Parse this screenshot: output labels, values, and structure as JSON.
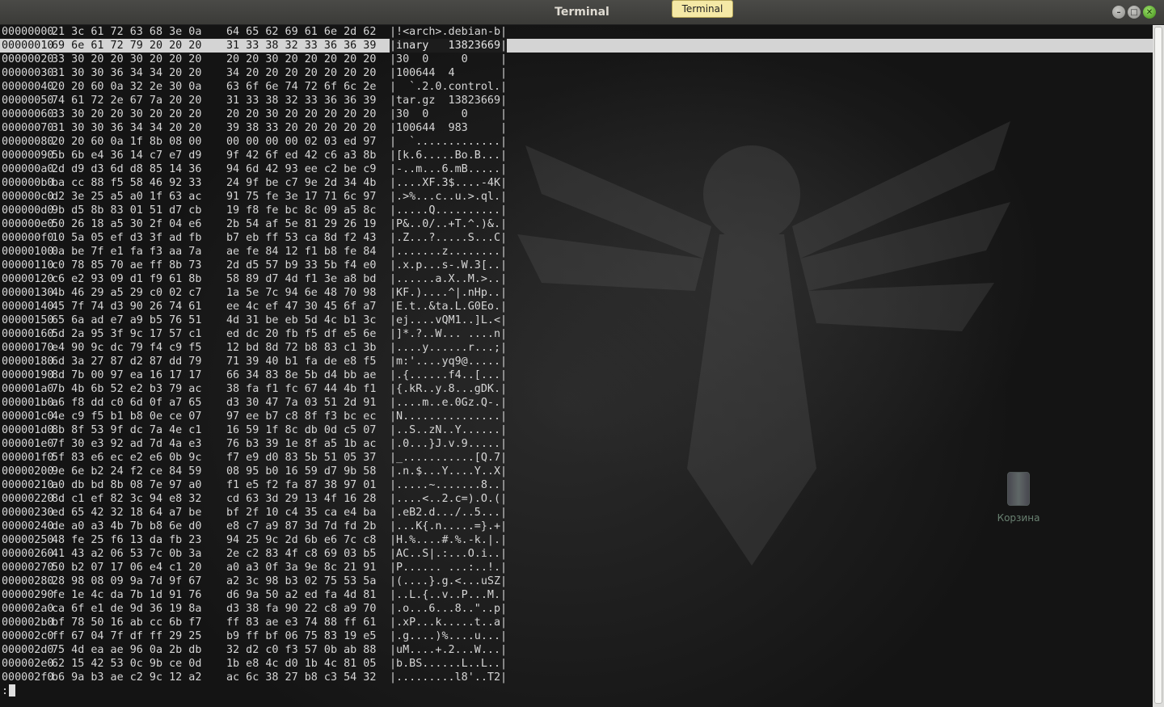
{
  "window": {
    "title": "Terminal",
    "tooltip": "Terminal",
    "buttons": {
      "minimize": "–",
      "maximize": "□",
      "close": "✕"
    }
  },
  "desktop": {
    "trash_label": "Корзина"
  },
  "colors": {
    "selection": "#d4d4d4",
    "text": "#d6d6d6",
    "close_button": "#4caf1e"
  },
  "terminal": {
    "selected_row": 1,
    "prompt": ":",
    "rows": [
      {
        "offset": "00000000",
        "hex1": "21 3c 61 72 63 68 3e 0a",
        "hex2": "64 65 62 69 61 6e 2d 62",
        "ascii": "|!<arch>.debian-b|"
      },
      {
        "offset": "00000010",
        "hex1": "69 6e 61 72 79 20 20 20",
        "hex2": "31 33 38 32 33 36 36 39",
        "ascii": "|inary   13823669|"
      },
      {
        "offset": "00000020",
        "hex1": "33 30 20 20 30 20 20 20",
        "hex2": "20 20 30 20 20 20 20 20",
        "ascii": "|30  0     0     |"
      },
      {
        "offset": "00000030",
        "hex1": "31 30 30 36 34 34 20 20",
        "hex2": "34 20 20 20 20 20 20 20",
        "ascii": "|100644  4       |"
      },
      {
        "offset": "00000040",
        "hex1": "20 20 60 0a 32 2e 30 0a",
        "hex2": "63 6f 6e 74 72 6f 6c 2e",
        "ascii": "|  `.2.0.control.|"
      },
      {
        "offset": "00000050",
        "hex1": "74 61 72 2e 67 7a 20 20",
        "hex2": "31 33 38 32 33 36 36 39",
        "ascii": "|tar.gz  13823669|"
      },
      {
        "offset": "00000060",
        "hex1": "33 30 20 20 30 20 20 20",
        "hex2": "20 20 30 20 20 20 20 20",
        "ascii": "|30  0     0     |"
      },
      {
        "offset": "00000070",
        "hex1": "31 30 30 36 34 34 20 20",
        "hex2": "39 38 33 20 20 20 20 20",
        "ascii": "|100644  983     |"
      },
      {
        "offset": "00000080",
        "hex1": "20 20 60 0a 1f 8b 08 00",
        "hex2": "00 00 00 00 02 03 ed 97",
        "ascii": "|  `.............|"
      },
      {
        "offset": "00000090",
        "hex1": "5b 6b e4 36 14 c7 e7 d9",
        "hex2": "9f 42 6f ed 42 c6 a3 8b",
        "ascii": "|[k.6.....Bo.B...|"
      },
      {
        "offset": "000000a0",
        "hex1": "2d d9 d3 6d d8 85 14 36",
        "hex2": "94 6d 42 93 ee c2 be c9",
        "ascii": "|-..m...6.mB.....|"
      },
      {
        "offset": "000000b0",
        "hex1": "ba cc 88 f5 58 46 92 33",
        "hex2": "24 9f be c7 9e 2d 34 4b",
        "ascii": "|....XF.3$....-4K|"
      },
      {
        "offset": "000000c0",
        "hex1": "d2 3e 25 a5 a0 1f 63 ac",
        "hex2": "91 75 fe 3e 17 71 6c 97",
        "ascii": "|.>%...c..u.>.ql.|"
      },
      {
        "offset": "000000d0",
        "hex1": "9b d5 8b 83 01 51 d7 cb",
        "hex2": "19 f8 fe bc 8c 09 a5 8c",
        "ascii": "|.....Q..........|"
      },
      {
        "offset": "000000e0",
        "hex1": "50 26 18 a5 30 2f 04 e6",
        "hex2": "2b 54 af 5e 81 29 26 19",
        "ascii": "|P&..0/..+T.^.)&.|"
      },
      {
        "offset": "000000f0",
        "hex1": "10 5a 05 ef d3 3f ad fb",
        "hex2": "b7 eb ff 53 ca 8d f2 43",
        "ascii": "|.Z...?.....S...C|"
      },
      {
        "offset": "00000100",
        "hex1": "0a be 7f e1 fa f3 aa 7a",
        "hex2": "ae fe 84 12 f1 b8 fe 84",
        "ascii": "|.......z........|"
      },
      {
        "offset": "00000110",
        "hex1": "c0 78 85 70 ae ff 8b 73",
        "hex2": "2d d5 57 b9 33 5b f4 e0",
        "ascii": "|.x.p...s-.W.3[..|"
      },
      {
        "offset": "00000120",
        "hex1": "c6 e2 93 09 d1 f9 61 8b",
        "hex2": "58 89 d7 4d f1 3e a8 bd",
        "ascii": "|......a.X..M.>..|"
      },
      {
        "offset": "00000130",
        "hex1": "4b 46 29 a5 29 c0 02 c7",
        "hex2": "1a 5e 7c 94 6e 48 70 98",
        "ascii": "|KF.)....^|.nHp..|"
      },
      {
        "offset": "00000140",
        "hex1": "45 7f 74 d3 90 26 74 61",
        "hex2": "ee 4c ef 47 30 45 6f a7",
        "ascii": "|E.t..&ta.L.G0Eo.|"
      },
      {
        "offset": "00000150",
        "hex1": "65 6a ad e7 a9 b5 76 51",
        "hex2": "4d 31 be eb 5d 4c b1 3c",
        "ascii": "|ej....vQM1..]L.<|"
      },
      {
        "offset": "00000160",
        "hex1": "5d 2a 95 3f 9c 17 57 c1",
        "hex2": "ed dc 20 fb f5 df e5 6e",
        "ascii": "|]*.?..W... ....n|"
      },
      {
        "offset": "00000170",
        "hex1": "e4 90 9c dc 79 f4 c9 f5",
        "hex2": "12 bd 8d 72 b8 83 c1 3b",
        "ascii": "|....y......r...;|"
      },
      {
        "offset": "00000180",
        "hex1": "6d 3a 27 87 d2 87 dd 79",
        "hex2": "71 39 40 b1 fa de e8 f5",
        "ascii": "|m:'....yq9@.....|"
      },
      {
        "offset": "00000190",
        "hex1": "8d 7b 00 97 ea 16 17 17",
        "hex2": "66 34 83 8e 5b d4 bb ae",
        "ascii": "|.{......f4..[...|"
      },
      {
        "offset": "000001a0",
        "hex1": "7b 4b 6b 52 e2 b3 79 ac",
        "hex2": "38 fa f1 fc 67 44 4b f1",
        "ascii": "|{.kR..y.8...gDK.|"
      },
      {
        "offset": "000001b0",
        "hex1": "a6 f8 dd c0 6d 0f a7 65",
        "hex2": "d3 30 47 7a 03 51 2d 91",
        "ascii": "|....m..e.0Gz.Q-.|"
      },
      {
        "offset": "000001c0",
        "hex1": "4e c9 f5 b1 b8 0e ce 07",
        "hex2": "97 ee b7 c8 8f f3 bc ec",
        "ascii": "|N...............|"
      },
      {
        "offset": "000001d0",
        "hex1": "8b 8f 53 9f dc 7a 4e c1",
        "hex2": "16 59 1f 8c db 0d c5 07",
        "ascii": "|..S..zN..Y......|"
      },
      {
        "offset": "000001e0",
        "hex1": "7f 30 e3 92 ad 7d 4a e3",
        "hex2": "76 b3 39 1e 8f a5 1b ac",
        "ascii": "|.0...}J.v.9.....|"
      },
      {
        "offset": "000001f0",
        "hex1": "5f 83 e6 ec e2 e6 0b 9c",
        "hex2": "f7 e9 d0 83 5b 51 05 37",
        "ascii": "|_...........[Q.7|"
      },
      {
        "offset": "00000200",
        "hex1": "9e 6e b2 24 f2 ce 84 59",
        "hex2": "08 95 b0 16 59 d7 9b 58",
        "ascii": "|.n.$...Y....Y..X|"
      },
      {
        "offset": "00000210",
        "hex1": "a0 db bd 8b 08 7e 97 a0",
        "hex2": "f1 e5 f2 fa 87 38 97 01",
        "ascii": "|.....~.......8..|"
      },
      {
        "offset": "00000220",
        "hex1": "8d c1 ef 82 3c 94 e8 32",
        "hex2": "cd 63 3d 29 13 4f 16 28",
        "ascii": "|....<..2.c=).O.(|"
      },
      {
        "offset": "00000230",
        "hex1": "ed 65 42 32 18 64 a7 be",
        "hex2": "bf 2f 10 c4 35 ca e4 ba",
        "ascii": "|.eB2.d.../..5...|"
      },
      {
        "offset": "00000240",
        "hex1": "de a0 a3 4b 7b b8 6e d0",
        "hex2": "e8 c7 a9 87 3d 7d fd 2b",
        "ascii": "|...K{.n.....=}.+|"
      },
      {
        "offset": "00000250",
        "hex1": "48 fe 25 f6 13 da fb 23",
        "hex2": "94 25 9c 2d 6b e6 7c c8",
        "ascii": "|H.%....#.%.-k.|.|"
      },
      {
        "offset": "00000260",
        "hex1": "41 43 a2 06 53 7c 0b 3a",
        "hex2": "2e c2 83 4f c8 69 03 b5",
        "ascii": "|AC..S|.:...O.i..|"
      },
      {
        "offset": "00000270",
        "hex1": "50 b2 07 17 06 e4 c1 20",
        "hex2": "a0 a3 0f 3a 9e 8c 21 91",
        "ascii": "|P...... ...:..!.|"
      },
      {
        "offset": "00000280",
        "hex1": "28 98 08 09 9a 7d 9f 67",
        "hex2": "a2 3c 98 b3 02 75 53 5a",
        "ascii": "|(....}.g.<...uSZ|"
      },
      {
        "offset": "00000290",
        "hex1": "fe 1e 4c da 7b 1d 91 76",
        "hex2": "d6 9a 50 a2 ed fa 4d 81",
        "ascii": "|..L.{..v..P...M.|"
      },
      {
        "offset": "000002a0",
        "hex1": "ca 6f e1 de 9d 36 19 8a",
        "hex2": "d3 38 fa 90 22 c8 a9 70",
        "ascii": "|.o...6...8..\"..p|"
      },
      {
        "offset": "000002b0",
        "hex1": "bf 78 50 16 ab cc 6b f7",
        "hex2": "ff 83 ae e3 74 88 ff 61",
        "ascii": "|.xP...k.....t..a|"
      },
      {
        "offset": "000002c0",
        "hex1": "ff 67 04 7f df ff 29 25",
        "hex2": "b9 ff bf 06 75 83 19 e5",
        "ascii": "|.g....)%....u...|"
      },
      {
        "offset": "000002d0",
        "hex1": "75 4d ea ae 96 0a 2b db",
        "hex2": "32 d2 c0 f3 57 0b ab 88",
        "ascii": "|uM....+.2...W...|"
      },
      {
        "offset": "000002e0",
        "hex1": "62 15 42 53 0c 9b ce 0d",
        "hex2": "1b e8 4c d0 1b 4c 81 05",
        "ascii": "|b.BS......L..L..|"
      },
      {
        "offset": "000002f0",
        "hex1": "b6 9a b3 ae c2 9c 12 a2",
        "hex2": "ac 6c 38 27 b8 c3 54 32",
        "ascii": "|.........l8'..T2|"
      }
    ]
  }
}
